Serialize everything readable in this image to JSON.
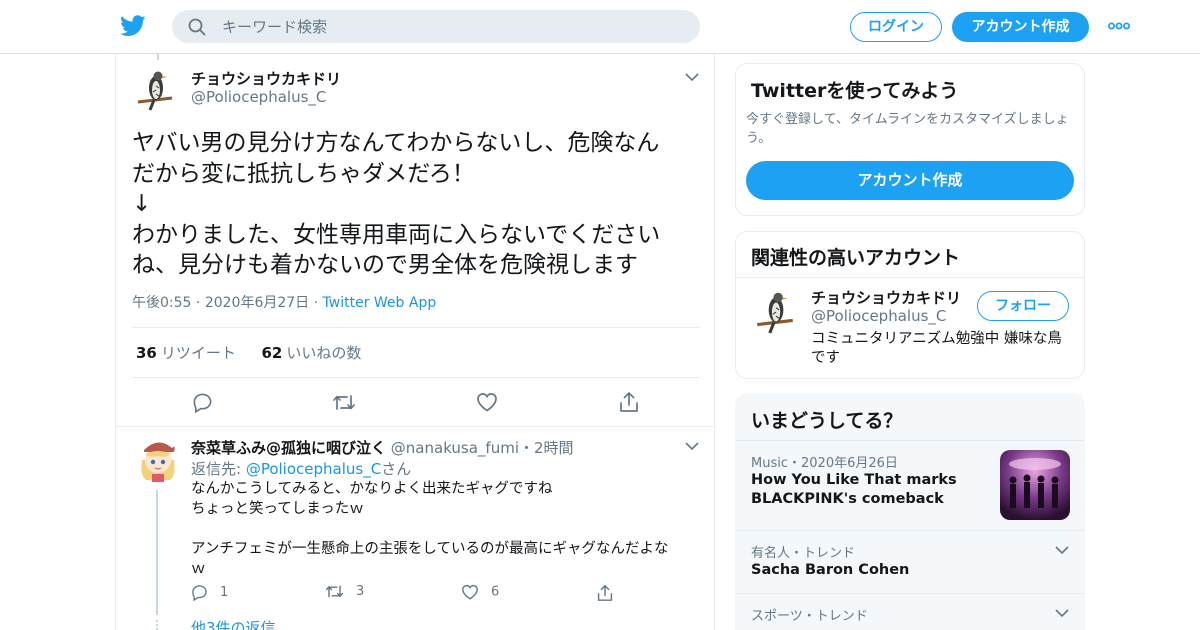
{
  "topbar": {
    "search_placeholder": "キーワード検索",
    "login_label": "ログイン",
    "signup_label": "アカウント作成"
  },
  "tweet": {
    "display_name": "チョウショウカキドリ",
    "handle": "@Poliocephalus_C",
    "text_lines": [
      "ヤバい男の見分け方なんてわからないし、危険なん",
      "だから変に抵抗しちゃダメだろ！",
      "↓",
      "わかりました、女性専用車両に入らないでください",
      "ね、見分けも着かないので男全体を危険視します"
    ],
    "time": "午後0:55",
    "date": "2020年6月27日",
    "source": "Twitter Web App",
    "retweet_count": "36",
    "retweet_label": "リツイート",
    "like_count": "62",
    "like_label": "いいねの数"
  },
  "reply": {
    "display_name": "奈菜草ふみ@孤独に咽び泣く",
    "handle": "@nanakusa_fumi",
    "time": "2時間",
    "reply_to_prefix": "返信先: ",
    "reply_to_handle": "@Poliocephalus_C",
    "reply_to_suffix": "さん",
    "text_lines": [
      "なんかこうしてみると、かなりよく出来たギャグですね",
      "ちょっと笑ってしまったｗ",
      "",
      "アンチフェミが一生懸命上の主張をしているのが最高にギャグなんだよな",
      "ｗ"
    ],
    "reply_count": "1",
    "retweet_count": "3",
    "like_count": "6",
    "more_replies": "他3件の返信"
  },
  "signup_card": {
    "title": "Twitterを使ってみよう",
    "desc": "今すぐ登録して、タイムラインをカスタマイズしましょう。",
    "button": "アカウント作成"
  },
  "related_card": {
    "title": "関連性の高いアカウント",
    "name": "チョウショウカキドリ",
    "handle": "@Poliocephalus_C",
    "follow_label": "フォロー",
    "bio": "コミュニタリアニズム勉強中 嫌味な鳥です"
  },
  "trends_card": {
    "title": "いまどうしてる？",
    "items": [
      {
        "category": "Music",
        "date": "2020年6月26日",
        "title_lines": [
          "How You Like That marks",
          "BLACKPINK's comeback"
        ]
      },
      {
        "category": "有名人・トレンド",
        "title": "Sacha Baron Cohen"
      },
      {
        "category": "スポーツ・トレンド",
        "title": ""
      }
    ]
  },
  "colors": {
    "accent": "#1da1f2",
    "link": "#1b95e0",
    "secondary_text": "#657786",
    "trend_bg": "#f5f8fa"
  }
}
